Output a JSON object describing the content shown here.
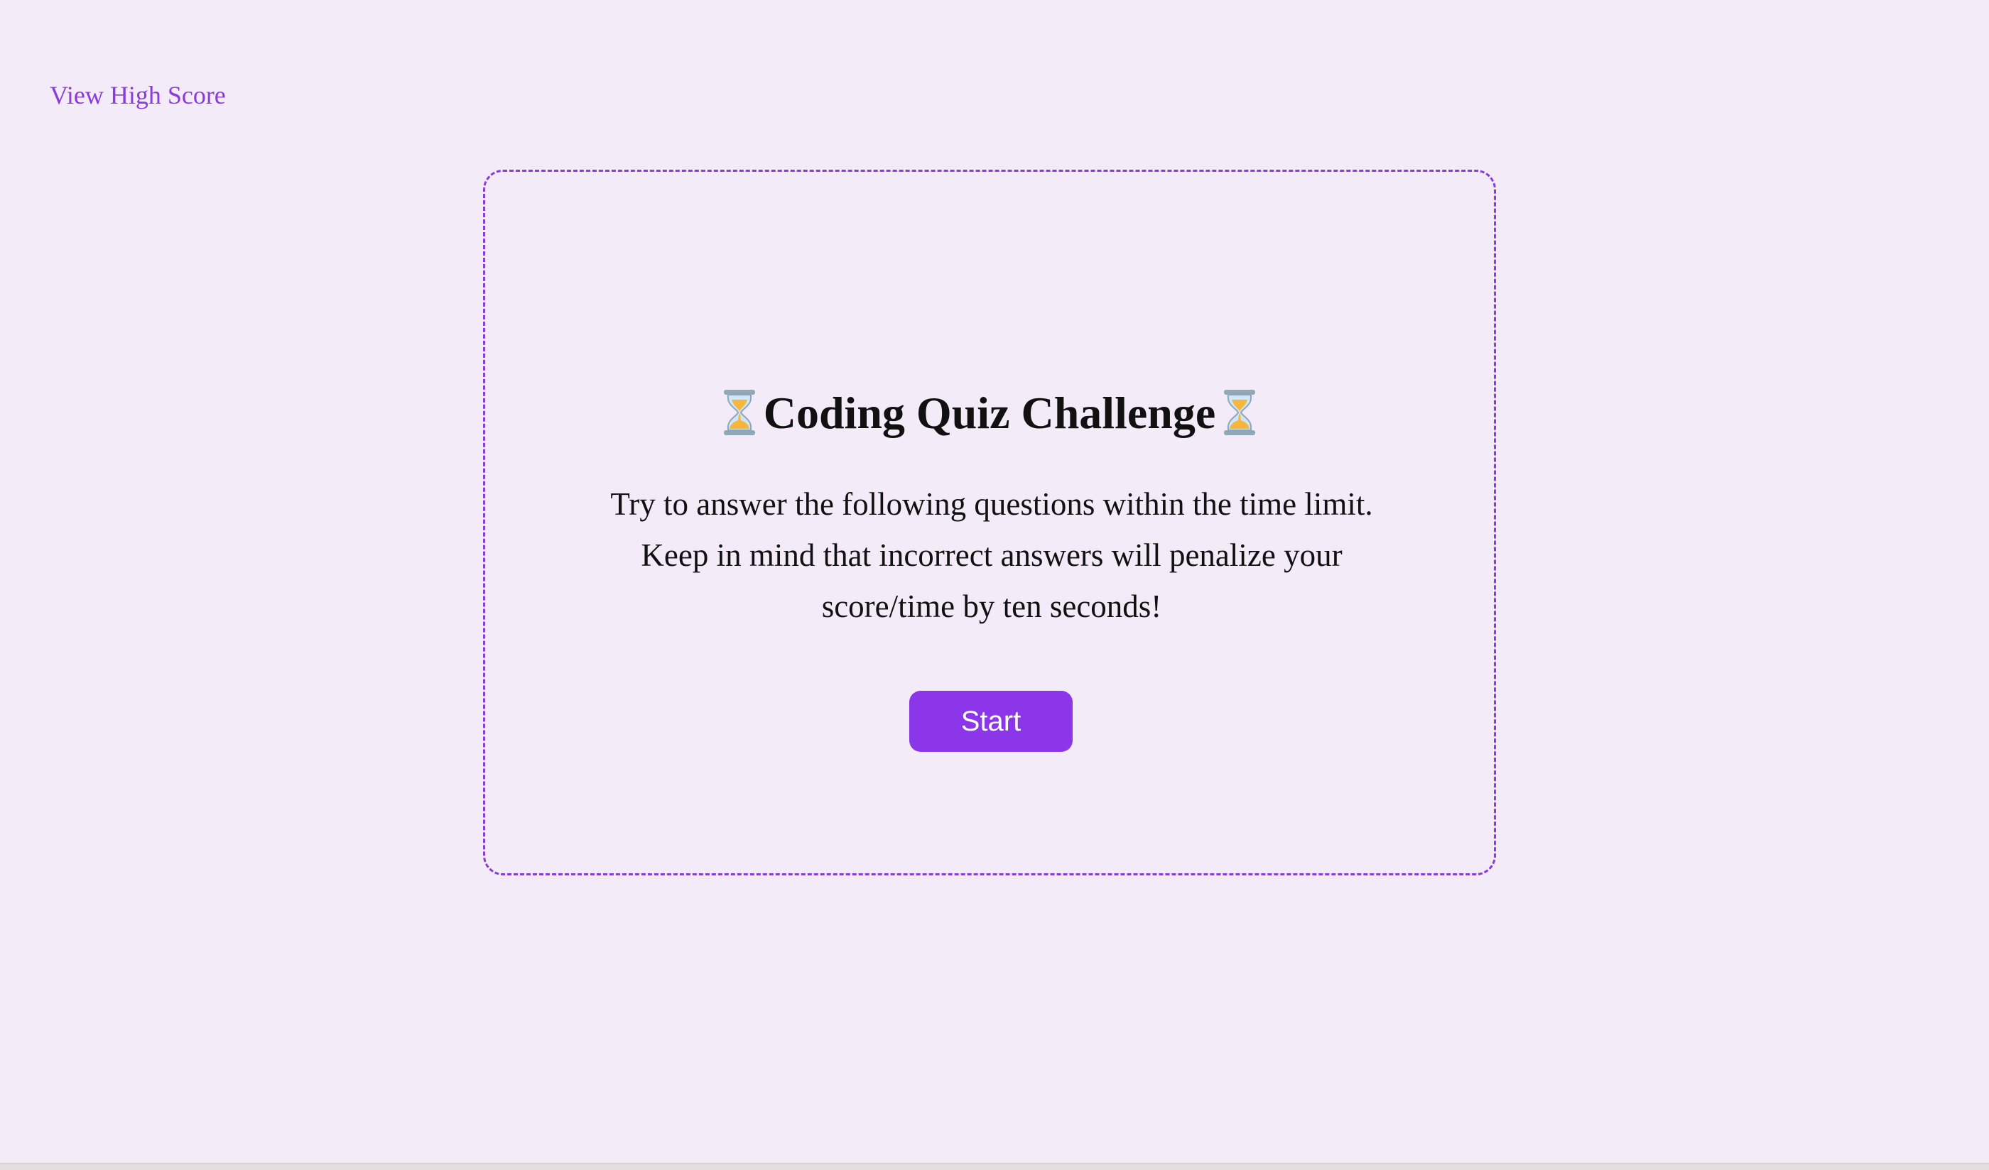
{
  "header": {
    "view_high_score_label": "View High Score"
  },
  "card": {
    "title": "Coding Quiz Challenge",
    "title_icon": "hourglass-icon",
    "description": "Try to answer the following questions within the time limit. Keep in mind that incorrect answers will penalize your score/time by ten seconds!",
    "start_label": "Start"
  },
  "colors": {
    "background": "#f3ecf8",
    "accent": "#8a3bd9",
    "button": "#8b36e8",
    "text": "#111111"
  }
}
